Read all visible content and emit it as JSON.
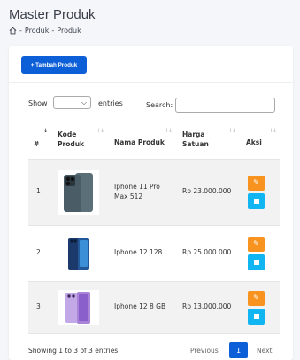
{
  "header": {
    "title": "Master Produk",
    "breadcrumb": [
      "Produk",
      "Produk"
    ],
    "separator": "-"
  },
  "toolbar": {
    "add_label": "+ Tambah Produk"
  },
  "table_controls": {
    "show_label": "Show",
    "entries_label": "entries",
    "search_label": "Search:"
  },
  "table": {
    "columns": [
      "#",
      "Kode Produk",
      "Nama Produk",
      "Harga Satuan",
      "Aksi"
    ],
    "rows": [
      {
        "no": "1",
        "name": "Iphone 11 Pro Max 512",
        "price": "Rp 23.000.000",
        "phone": "iphone-11-pro-icon"
      },
      {
        "no": "2",
        "name": "Iphone 12 128",
        "price": "Rp 25.000.000",
        "phone": "iphone-12-blue-icon"
      },
      {
        "no": "3",
        "name": "Iphone 12 8 GB",
        "price": "Rp 13.000.000",
        "phone": "iphone-12-purple-icon"
      }
    ]
  },
  "footer": {
    "info": "Showing 1 to 3 of 3 entries",
    "previous": "Previous",
    "current_page": "1",
    "next": "Next"
  },
  "colors": {
    "primary": "#0d5fd8",
    "edit": "#f7931e",
    "delete": "#11b5f2",
    "background": "#f4f6f9"
  }
}
